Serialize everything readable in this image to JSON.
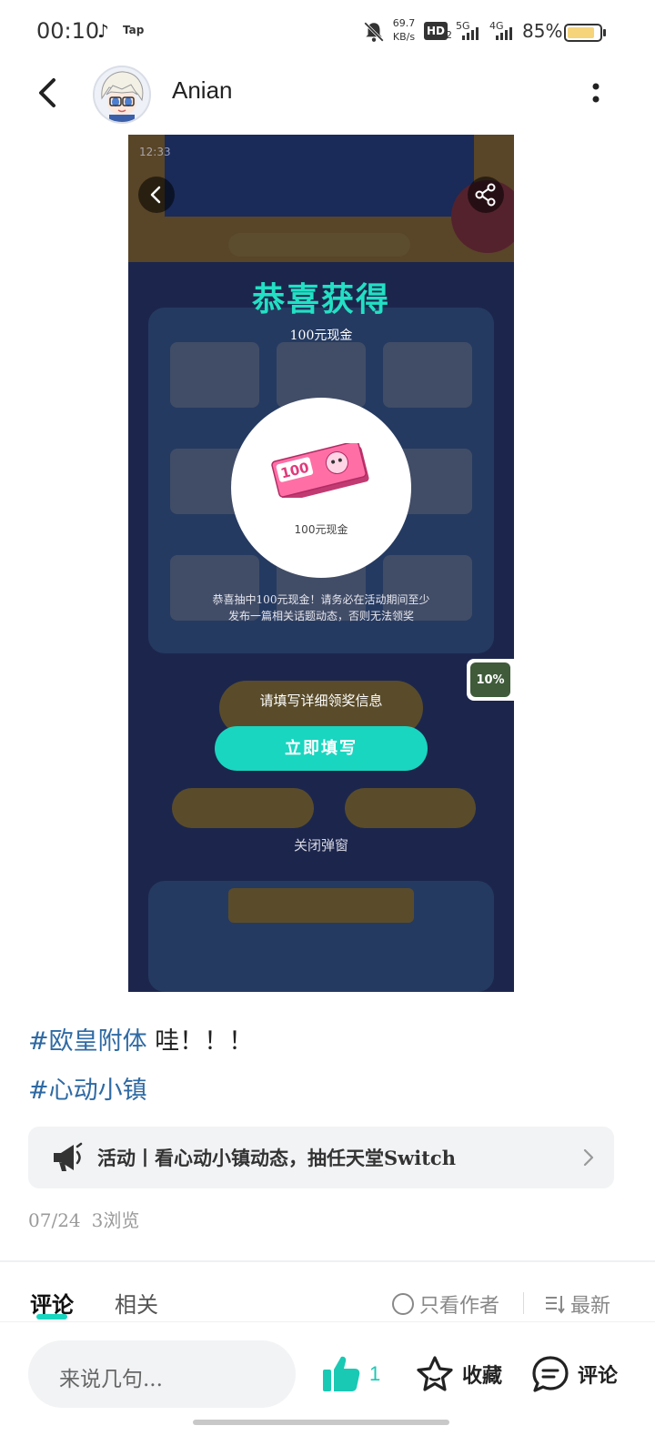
{
  "status_bar": {
    "time": "00:10",
    "app_label": "Tap",
    "net_speed_value": "69.7",
    "net_speed_unit": "KB/s",
    "hd_label": "HD",
    "hd_sub": "2",
    "sim1_label": "5G",
    "sim2_label": "4G",
    "battery_percent": "85%",
    "battery_level": 0.85
  },
  "header": {
    "author_name": "Anian",
    "back_icon": "back-arrow-icon",
    "more_icon": "more-vertical-icon"
  },
  "post_image": {
    "popup_title": "恭喜获得",
    "popup_subtitle": "100元现金",
    "prize_caption": "100元现金",
    "prize_ticket_text": "100",
    "notice_line1": "恭喜抽中100元现金！请务必在活动期间至少",
    "notice_line2": "发布一篇相关话题动态，否则无法领奖",
    "percent_badge": "10%",
    "fill_prompt": "请填写详细领奖信息",
    "fill_button": "立即填写",
    "close_popup": "关闭弹窗",
    "accent_color": "#19d6c0"
  },
  "post": {
    "tags": [
      {
        "tag": "#欧皇附体",
        "text": " 哇！！！"
      },
      {
        "tag": "#心动小镇",
        "text": ""
      }
    ],
    "activity_banner": "活动丨看心动小镇动态，抽任天堂Switch",
    "date": "07/24",
    "views": "3浏览"
  },
  "tabs": {
    "comments": "评论",
    "related": "相关",
    "author_only": "只看作者",
    "sort": "最新"
  },
  "bottom_bar": {
    "input_placeholder": "来说几句...",
    "like_count": "1",
    "favorite_label": "收藏",
    "comment_label": "评论"
  }
}
